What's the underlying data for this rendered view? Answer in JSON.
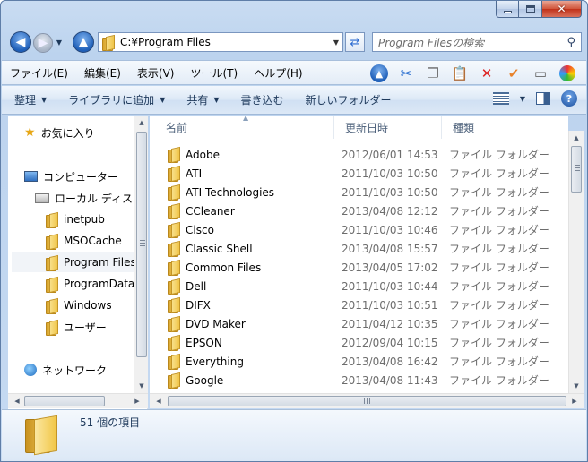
{
  "nav": {
    "address": "C:¥Program Files",
    "search_placeholder": "Program Filesの検索"
  },
  "menu": [
    "ファイル(E)",
    "編集(E)",
    "表示(V)",
    "ツール(T)",
    "ヘルプ(H)"
  ],
  "toolbar_icons": [
    "up-folder-icon",
    "cut-icon",
    "copy-icon",
    "paste-icon",
    "delete-icon",
    "check-icon",
    "properties-icon",
    "color-icon"
  ],
  "commands": {
    "organize": "整理",
    "include_library": "ライブラリに追加",
    "share": "共有",
    "burn": "書き込む",
    "new_folder": "新しいフォルダー"
  },
  "sidebar": {
    "favorites": "お気に入り",
    "computer": "コンピューター",
    "local_disk": "ローカル ディス",
    "folders": [
      "inetpub",
      "MSOCache",
      "Program Files",
      "ProgramData",
      "Windows",
      "ユーザー"
    ],
    "selected_index": 2,
    "network": "ネットワーク"
  },
  "columns": {
    "name": "名前",
    "date": "更新日時",
    "type": "種類"
  },
  "files": [
    {
      "name": "Adobe",
      "date": "2012/06/01 14:53",
      "type": "ファイル フォルダー"
    },
    {
      "name": "ATI",
      "date": "2011/10/03 10:50",
      "type": "ファイル フォルダー"
    },
    {
      "name": "ATI Technologies",
      "date": "2011/10/03 10:50",
      "type": "ファイル フォルダー"
    },
    {
      "name": "CCleaner",
      "date": "2013/04/08 12:12",
      "type": "ファイル フォルダー"
    },
    {
      "name": "Cisco",
      "date": "2011/10/03 10:46",
      "type": "ファイル フォルダー"
    },
    {
      "name": "Classic Shell",
      "date": "2013/04/08 15:57",
      "type": "ファイル フォルダー"
    },
    {
      "name": "Common Files",
      "date": "2013/04/05 17:02",
      "type": "ファイル フォルダー"
    },
    {
      "name": "Dell",
      "date": "2011/10/03 10:44",
      "type": "ファイル フォルダー"
    },
    {
      "name": "DIFX",
      "date": "2011/10/03 10:51",
      "type": "ファイル フォルダー"
    },
    {
      "name": "DVD Maker",
      "date": "2011/04/12 10:35",
      "type": "ファイル フォルダー"
    },
    {
      "name": "EPSON",
      "date": "2012/09/04 10:15",
      "type": "ファイル フォルダー"
    },
    {
      "name": "Everything",
      "date": "2013/04/08 16:42",
      "type": "ファイル フォルダー"
    },
    {
      "name": "Google",
      "date": "2013/04/08 11:43",
      "type": "ファイル フォルダー"
    }
  ],
  "status": {
    "item_count": "51 個の項目"
  }
}
